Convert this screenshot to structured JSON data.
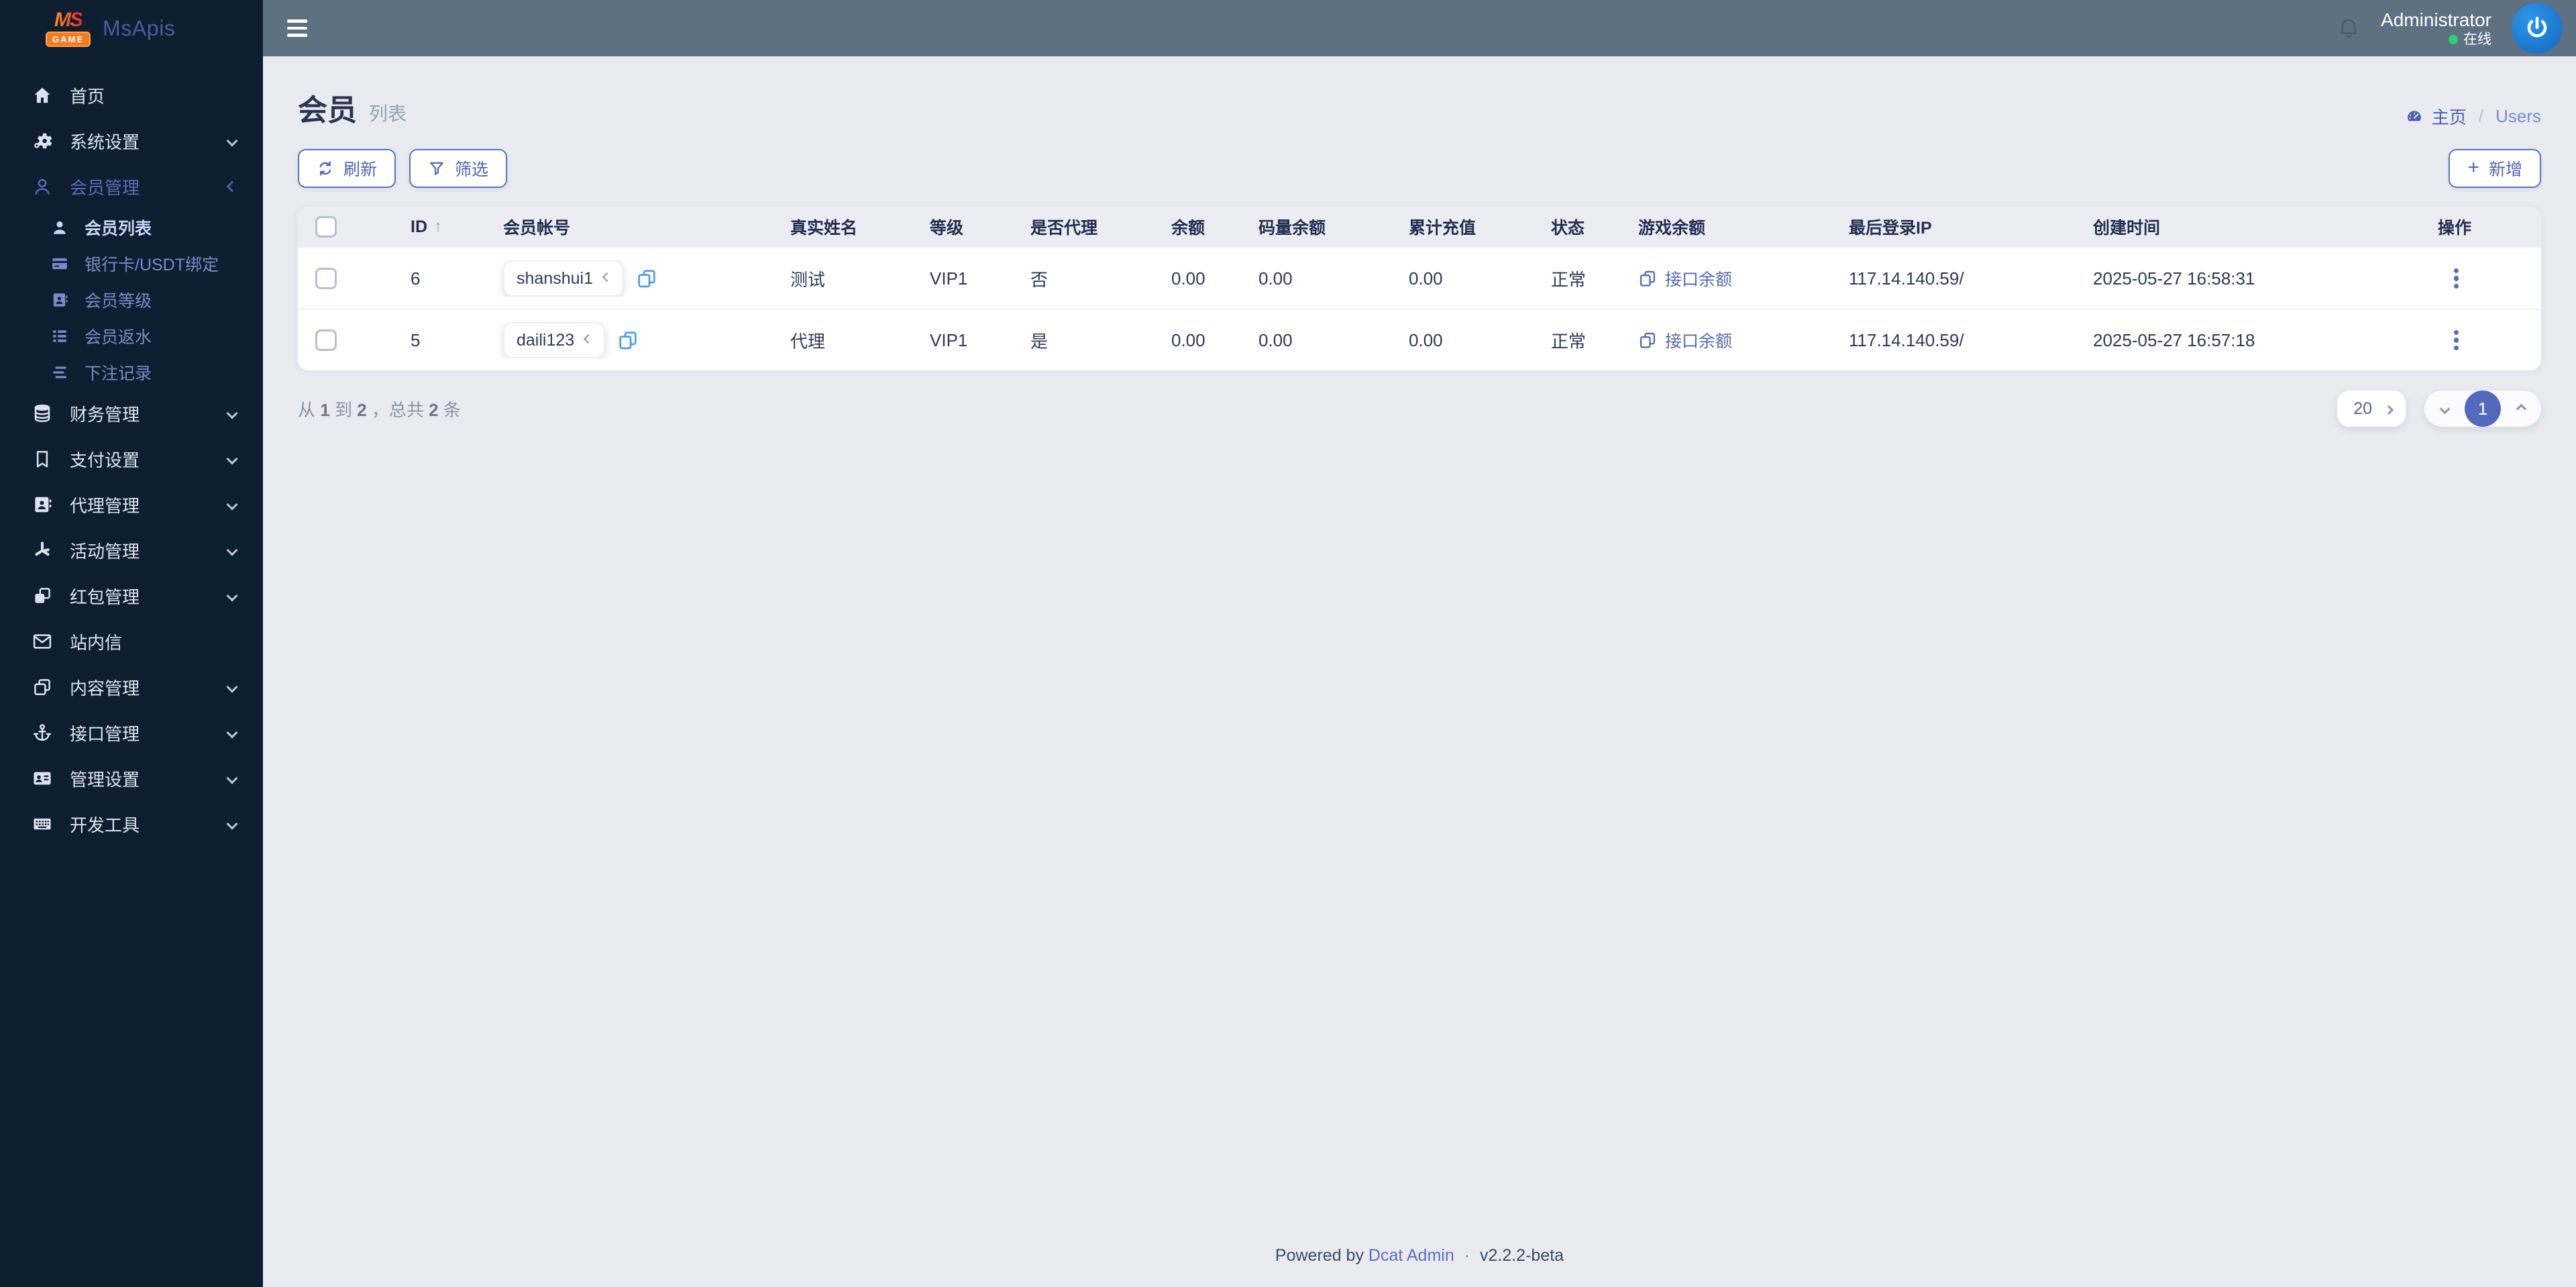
{
  "brand": {
    "logo_top": "MS",
    "logo_badge": "GAME",
    "app_name": "MsApis"
  },
  "navbar": {
    "user_name": "Administrator",
    "online_status": "在线"
  },
  "sidebar": {
    "items": [
      {
        "label": "首页",
        "icon": "home-icon"
      },
      {
        "label": "系统设置",
        "icon": "gears-icon",
        "chevron": "collapsed"
      },
      {
        "label": "会员管理",
        "icon": "user-icon",
        "chevron": "expanded",
        "children": [
          {
            "label": "会员列表",
            "icon": "user-solid-icon",
            "active": true
          },
          {
            "label": "银行卡/USDT绑定",
            "icon": "credit-card-icon"
          },
          {
            "label": "会员等级",
            "icon": "address-card-icon"
          },
          {
            "label": "会员返水",
            "icon": "list-icon"
          },
          {
            "label": "下注记录",
            "icon": "stream-icon"
          }
        ]
      },
      {
        "label": "财务管理",
        "icon": "database-icon",
        "chevron": "collapsed"
      },
      {
        "label": "支付设置",
        "icon": "bookmark-icon",
        "chevron": "collapsed"
      },
      {
        "label": "代理管理",
        "icon": "address-book-icon",
        "chevron": "collapsed"
      },
      {
        "label": "活动管理",
        "icon": "spark-icon",
        "chevron": "collapsed"
      },
      {
        "label": "红包管理",
        "icon": "clone-icon",
        "chevron": "collapsed"
      },
      {
        "label": "站内信",
        "icon": "envelope-icon"
      },
      {
        "label": "内容管理",
        "icon": "copy-icon",
        "chevron": "collapsed"
      },
      {
        "label": "接口管理",
        "icon": "anchor-icon",
        "chevron": "collapsed"
      },
      {
        "label": "管理设置",
        "icon": "id-card-icon",
        "chevron": "collapsed"
      },
      {
        "label": "开发工具",
        "icon": "keyboard-icon",
        "chevron": "collapsed"
      }
    ]
  },
  "page": {
    "title": "会员",
    "subtitle": "列表",
    "breadcrumb": {
      "home": "主页",
      "separator": "/",
      "current": "Users"
    }
  },
  "toolbar": {
    "refresh_label": "刷新",
    "filter_label": "筛选",
    "add_label": "新增"
  },
  "table": {
    "headers": {
      "id": "ID",
      "account": "会员帐号",
      "real_name": "真实姓名",
      "level": "等级",
      "is_agent": "是否代理",
      "balance": "余额",
      "code_balance": "码量余额",
      "total_recharge": "累计充值",
      "status": "状态",
      "game_balance": "游戏余额",
      "last_login_ip": "最后登录IP",
      "created_at": "创建时间",
      "actions": "操作"
    },
    "rows": [
      {
        "id": "6",
        "account": "shanshui1",
        "real_name": "测试",
        "level": "VIP1",
        "is_agent": "否",
        "balance": "0.00",
        "code_balance": "0.00",
        "total_recharge": "0.00",
        "status": "正常",
        "game_balance": "接口余额",
        "last_login_ip": "117.14.140.59/",
        "created_at": "2025-05-27 16:58:31"
      },
      {
        "id": "5",
        "account": "daili123",
        "real_name": "代理",
        "level": "VIP1",
        "is_agent": "是",
        "balance": "0.00",
        "code_balance": "0.00",
        "total_recharge": "0.00",
        "status": "正常",
        "game_balance": "接口余额",
        "last_login_ip": "117.14.140.59/",
        "created_at": "2025-05-27 16:57:18"
      }
    ]
  },
  "pagination": {
    "summary": {
      "from_label": "从",
      "from": "1",
      "to_label": "到",
      "to": "2",
      "comma": "，",
      "total_label": "总共",
      "total": "2",
      "unit": "条"
    },
    "page_size": "20",
    "current_page": "1"
  },
  "footer": {
    "powered_by": "Powered by",
    "brand_link": "Dcat Admin",
    "separator": "·",
    "version": "v2.2.2-beta"
  },
  "colors": {
    "accent": "#586cb1",
    "navbar_bg": "#5e7183",
    "sidebar_bg": "#0e1e31",
    "content_bg": "#e9ebf1",
    "online_green": "#2fcf6f",
    "avatar_blue": "#1b80d6",
    "copy_icon_blue": "#4a9bf0"
  }
}
